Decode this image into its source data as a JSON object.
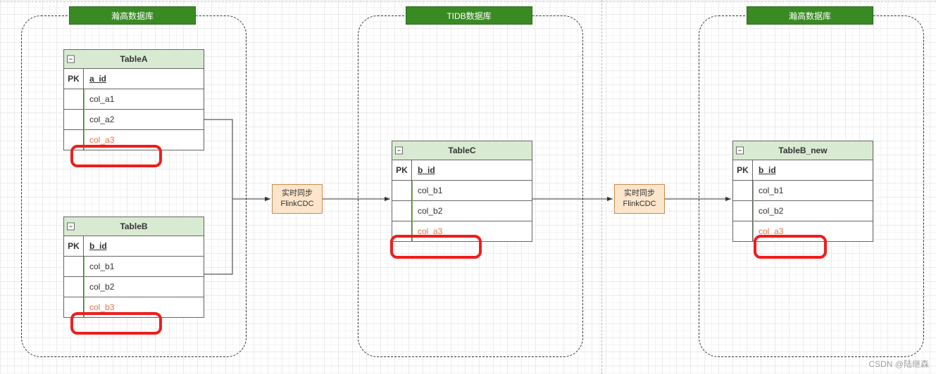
{
  "diagram": {
    "containers": [
      {
        "id": "c1",
        "label": "瀚高数据库"
      },
      {
        "id": "c2",
        "label": "TIDB数据库"
      },
      {
        "id": "c3",
        "label": "瀚高数据库"
      }
    ],
    "processes": [
      {
        "id": "p1",
        "line1": "实时同步",
        "line2": "FlinkCDC"
      },
      {
        "id": "p2",
        "line1": "实时同步",
        "line2": "FlinkCDC"
      }
    ]
  },
  "pk_label": "PK",
  "collapse_glyph": "–",
  "tables": {
    "tableA": {
      "title": "TableA",
      "pk": "a_id",
      "cols": [
        "col_a1",
        "col_a2",
        "col_a3"
      ],
      "highlight_index": 2
    },
    "tableB": {
      "title": "TableB",
      "pk": "b_id",
      "cols": [
        "col_b1",
        "col_b2",
        "col_b3"
      ],
      "highlight_index": 2
    },
    "tableC": {
      "title": "TableC",
      "pk": "b_id",
      "cols": [
        "col_b1",
        "col_b2",
        "col_a3"
      ],
      "highlight_index": 2
    },
    "tableBnew": {
      "title": "TableB_new",
      "pk": "b_id",
      "cols": [
        "col_b1",
        "col_b2",
        "col_a3"
      ],
      "highlight_index": 2
    }
  },
  "watermark": "CSDN @陆继森"
}
